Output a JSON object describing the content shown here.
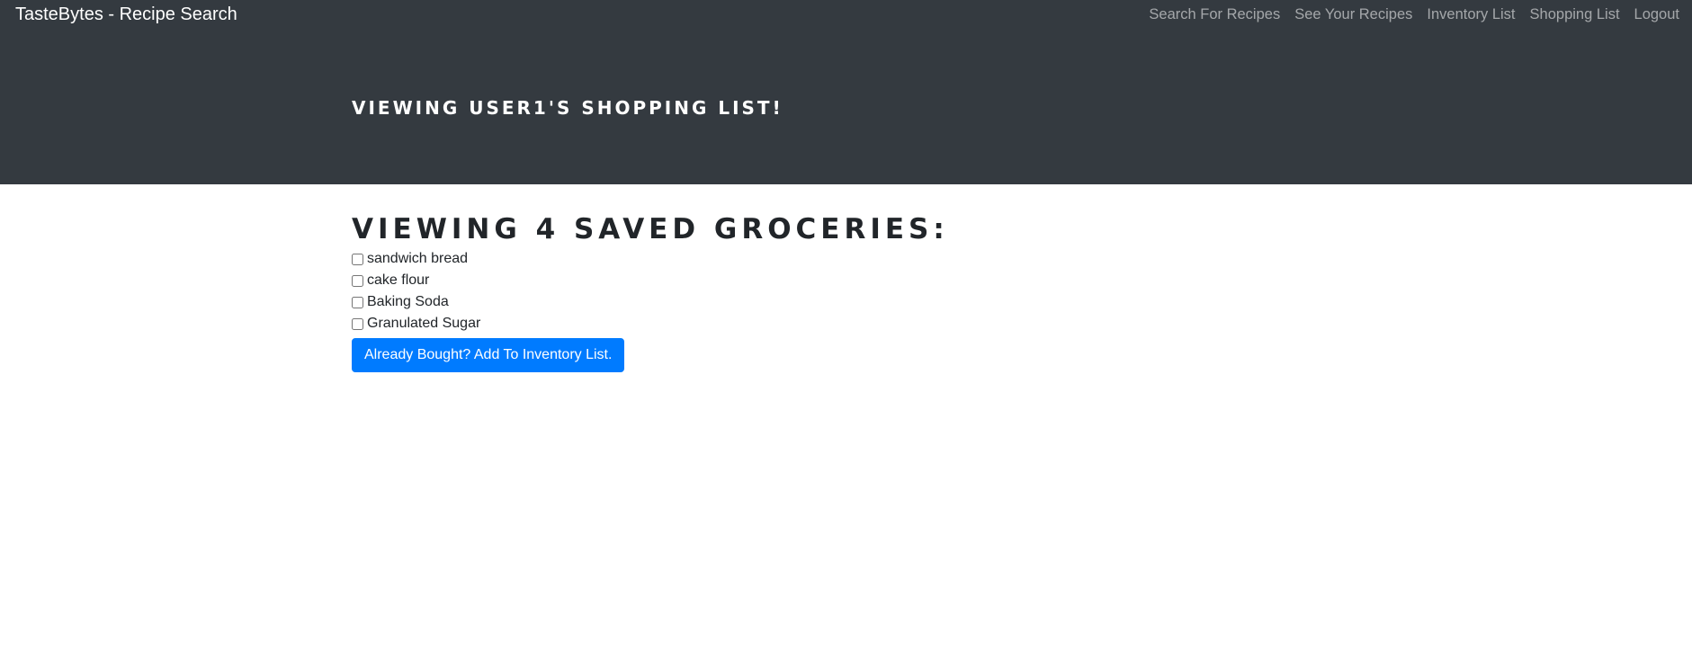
{
  "navbar": {
    "brand": "TasteBytes - Recipe Search",
    "links": [
      {
        "label": "Search For Recipes"
      },
      {
        "label": "See Your Recipes"
      },
      {
        "label": "Inventory List"
      },
      {
        "label": "Shopping List"
      },
      {
        "label": "Logout"
      }
    ]
  },
  "header": {
    "title": "Viewing User1's Shopping List!"
  },
  "main": {
    "title": "Viewing 4 Saved Groceries:",
    "groceries": [
      {
        "label": "sandwich bread",
        "checked": false
      },
      {
        "label": "cake flour",
        "checked": false
      },
      {
        "label": "Baking Soda",
        "checked": false
      },
      {
        "label": "Granulated Sugar",
        "checked": false
      }
    ],
    "submit_label": "Already Bought? Add To Inventory List."
  },
  "colors": {
    "navbar_bg": "#343a40",
    "primary": "#007bff",
    "text": "#212529"
  }
}
